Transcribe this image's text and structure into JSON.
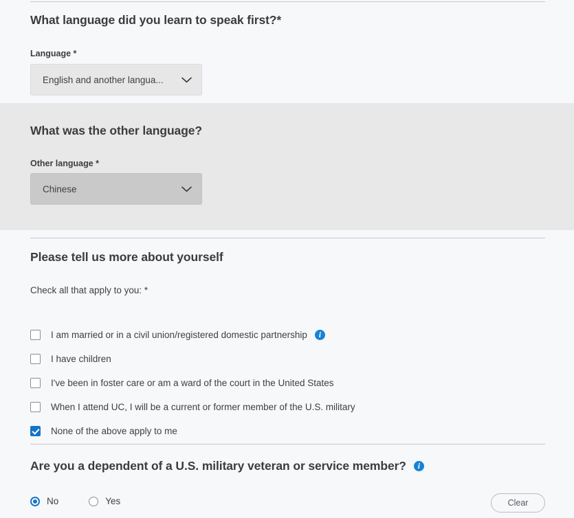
{
  "sections": {
    "language": {
      "heading": "What language did you learn to speak first?*",
      "field_label": "Language *",
      "selected_value": "English and another langua...",
      "chevron_icon": "chevron-down-icon"
    },
    "other_language": {
      "heading": "What was the other language?",
      "field_label": "Other language *",
      "selected_value": "Chinese",
      "chevron_icon": "chevron-down-icon"
    },
    "about_yourself": {
      "heading": "Please tell us more about yourself",
      "helper_text": "Check all that apply to you: *",
      "options": [
        {
          "label": "I am married or in a civil union/registered domestic partnership",
          "checked": false,
          "info_icon": "info-icon"
        },
        {
          "label": "I have children",
          "checked": false,
          "info_icon": null
        },
        {
          "label": "I've been in foster care or am a ward of the court in the United States",
          "checked": false,
          "info_icon": null
        },
        {
          "label": "When I attend UC, I will be a current or former member of the U.S. military",
          "checked": false,
          "info_icon": null
        },
        {
          "label": "None of the above apply to me",
          "checked": true,
          "info_icon": null
        }
      ]
    },
    "dependent": {
      "heading": "Are you a dependent of a U.S. military veteran or service member?",
      "info_icon": "info-icon",
      "options": [
        {
          "label": "No",
          "selected": true
        },
        {
          "label": "Yes",
          "selected": false
        }
      ],
      "clear_label": "Clear"
    }
  },
  "colors": {
    "page_background": "#f7f8fa",
    "band_background": "#e8e8e8",
    "accent_blue": "#1274c8",
    "info_blue": "#1783d4",
    "divider": "#c4c7cc",
    "select_light": "#e7e7e7",
    "select_dark": "#c9c9c9"
  }
}
